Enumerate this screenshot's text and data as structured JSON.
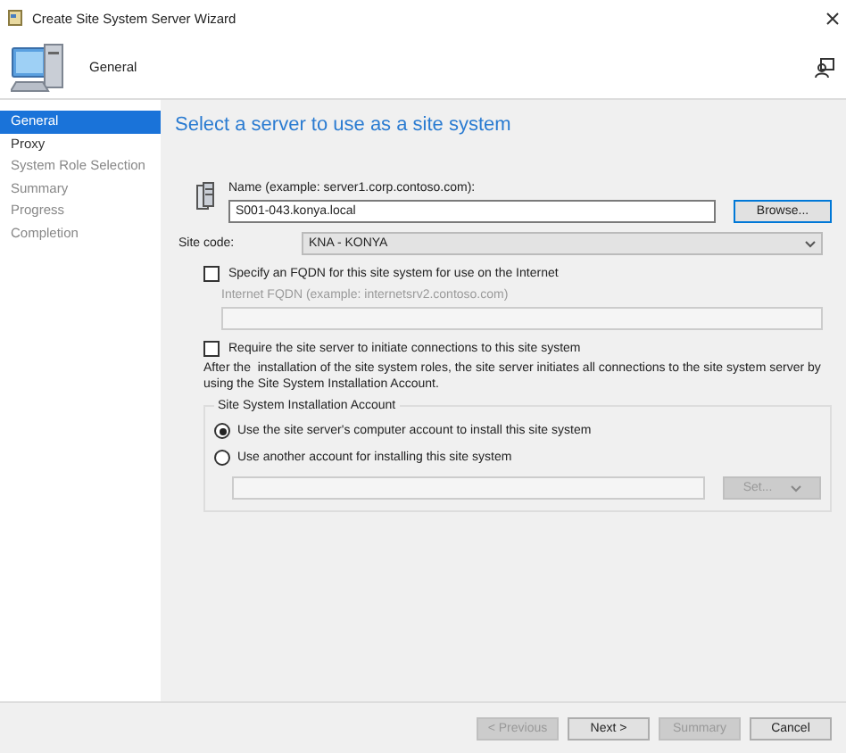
{
  "window": {
    "title": "Create Site System Server Wizard"
  },
  "header": {
    "title": "General"
  },
  "nav": [
    {
      "label": "General",
      "selected": true,
      "disabled": false
    },
    {
      "label": "Proxy",
      "selected": false,
      "disabled": false
    },
    {
      "label": "System Role Selection",
      "selected": false,
      "disabled": true
    },
    {
      "label": "Summary",
      "selected": false,
      "disabled": true
    },
    {
      "label": "Progress",
      "selected": false,
      "disabled": true
    },
    {
      "label": "Completion",
      "selected": false,
      "disabled": true
    }
  ],
  "heading": "Select a server to use as a site system",
  "name_field": {
    "label": "Name (example: server1.corp.contoso.com):",
    "value": "S001-043.konya.local"
  },
  "browse_button": {
    "label": "Browse..."
  },
  "site_code": {
    "label": "Site code:",
    "value": "KNA - KONYA"
  },
  "fqdn_checkbox": {
    "label": "Specify an FQDN for this site system for use on the Internet",
    "checked": false
  },
  "fqdn_field": {
    "label": "Internet FQDN (example: internetsrv2.contoso.com)",
    "disabled": true
  },
  "require_checkbox": {
    "label": "Require the site server to initiate connections to this site system",
    "checked": false
  },
  "description": "After the  installation of the site system roles, the site server initiates all connections to the site system server by using the Site System Installation Account.",
  "account_group": {
    "title": "Site System Installation Account",
    "options": [
      {
        "label": "Use the site server's computer account to install this site system",
        "selected": true
      },
      {
        "label": "Use another account for installing this site system",
        "selected": false
      }
    ],
    "account_field": {
      "disabled": true
    },
    "set_button": {
      "label": "Set...",
      "disabled": true
    }
  },
  "buttons": [
    {
      "label": "< Previous",
      "disabled": true
    },
    {
      "label": "Next >",
      "disabled": false
    },
    {
      "label": "Summary",
      "disabled": true
    },
    {
      "label": "Cancel",
      "disabled": false
    }
  ]
}
